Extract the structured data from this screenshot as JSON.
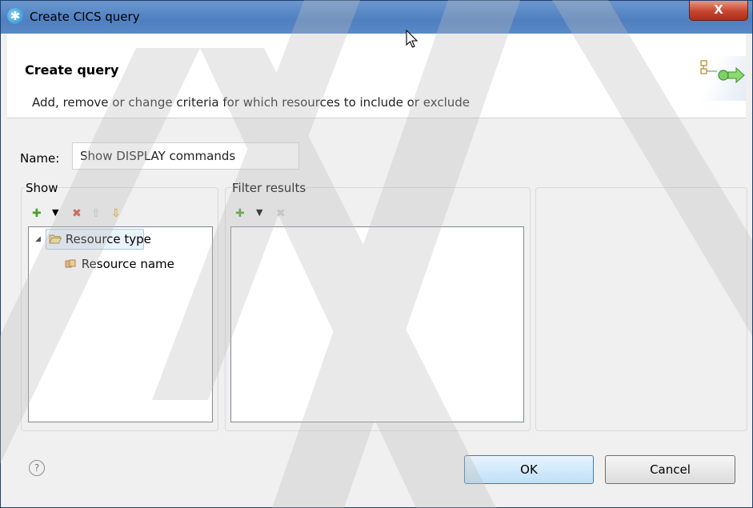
{
  "window": {
    "title": "Create CICS query",
    "close_glyph": "X"
  },
  "header": {
    "title": "Create query",
    "description": "Add, remove or change criteria for which resources to include or exclude",
    "icon": "query-wizard-icon"
  },
  "name_field": {
    "label": "Name:",
    "value": "Show DISPLAY commands"
  },
  "show_group": {
    "label": "Show",
    "toolbar": [
      "add-icon",
      "dropdown-arrow-icon",
      "delete-icon",
      "move-up-icon",
      "move-down-icon"
    ],
    "tree": [
      {
        "label": "Resource type",
        "expanded": true,
        "selected": true,
        "icon": "folder-open-icon"
      },
      {
        "label": "Resource name",
        "expanded": false,
        "selected": false,
        "icon": "resource-icon"
      }
    ]
  },
  "filter_group": {
    "label": "Filter results",
    "toolbar": [
      "add-icon",
      "dropdown-arrow-icon",
      "delete-icon"
    ]
  },
  "buttons": {
    "ok": "OK",
    "cancel": "Cancel",
    "help": "?"
  },
  "colors": {
    "title_bar": "#5a89c7",
    "close_button": "#c6452e",
    "add_icon": "#4aa02c",
    "delete_icon": "#d6402f",
    "move_icon": "#e8a325",
    "dialog_bg": "#f0f0f0"
  }
}
